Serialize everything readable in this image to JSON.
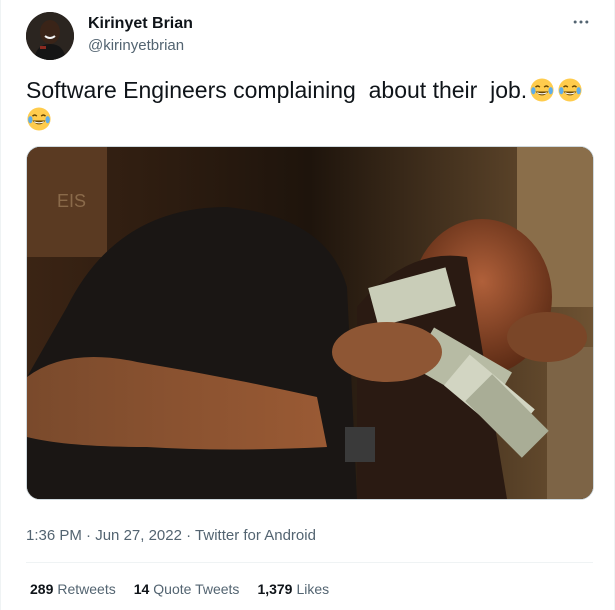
{
  "author": {
    "name": "Kirinyet Brian",
    "handle": "@kirinyetbrian"
  },
  "tweet": {
    "text": "Software Engineers complaining  about their  job.",
    "emojis": [
      "face-with-tears-of-joy",
      "face-with-tears-of-joy",
      "face-with-tears-of-joy"
    ]
  },
  "media": {
    "sign_text": "EIS"
  },
  "meta": {
    "time": "1:36 PM",
    "sep1": " · ",
    "date": "Jun 27, 2022",
    "sep2": " · ",
    "source": "Twitter for Android"
  },
  "stats": {
    "retweets_count": "289",
    "retweets_label": "Retweets",
    "quotes_count": "14",
    "quotes_label": "Quote Tweets",
    "likes_count": "1,379",
    "likes_label": "Likes"
  },
  "colors": {
    "text_primary": "#0f1419",
    "text_secondary": "#536471",
    "border": "#eff3f4"
  }
}
